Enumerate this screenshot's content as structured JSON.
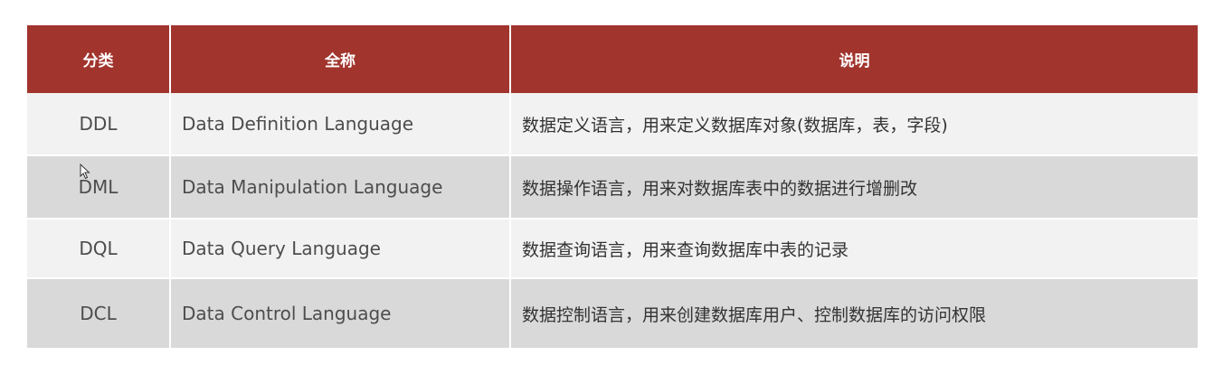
{
  "table": {
    "headers": [
      "分类",
      "全称",
      "说明"
    ],
    "rows": [
      {
        "category": "DDL",
        "full_name": "Data Definition Language",
        "description": "数据定义语言，用来定义数据库对象(数据库，表，字段)"
      },
      {
        "category": "DML",
        "full_name": "Data Manipulation Language",
        "description": "数据操作语言，用来对数据库表中的数据进行增删改"
      },
      {
        "category": "DQL",
        "full_name": "Data Query Language",
        "description": "数据查询语言，用来查询数据库中表的记录"
      },
      {
        "category": "DCL",
        "full_name": "Data Control Language",
        "description": "数据控制语言，用来创建数据库用户、控制数据库的访问权限"
      }
    ]
  },
  "colors": {
    "header_bg": "#a1342d",
    "row_light": "#f2f2f2",
    "row_dark": "#d9d9d9"
  },
  "icons": {
    "cursor": "mouse-pointer-icon"
  }
}
